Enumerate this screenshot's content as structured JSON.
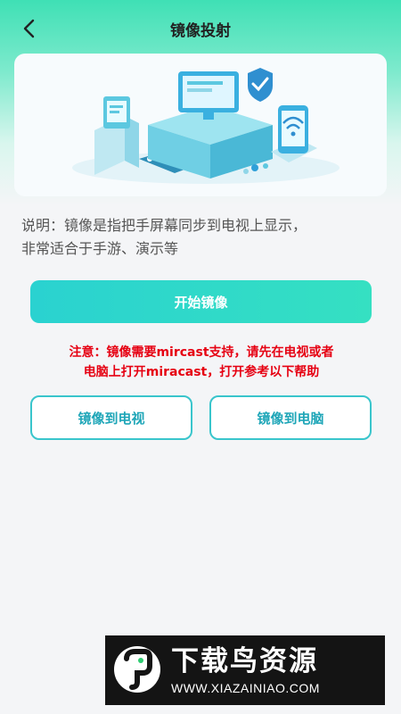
{
  "header": {
    "title": "镜像投射",
    "back_icon": "chevron-left-icon"
  },
  "banner": {
    "illustration": "screen-mirroring-illustration"
  },
  "description": {
    "line1": "说明：镜像是指把手屏幕同步到电视上显示，",
    "line2": "非常适合于手游、演示等"
  },
  "start_button": {
    "label": "开始镜像"
  },
  "notice": {
    "line1": "注意：镜像需要mircast支持，请先在电视或者",
    "line2": "电脑上打开miracast，打开参考以下帮助"
  },
  "options": {
    "tv_label": "镜像到电视",
    "pc_label": "镜像到电脑"
  },
  "watermark": {
    "title": "下载鸟资源",
    "url": "WWW.XIAZAINIAO.COM"
  },
  "colors": {
    "accent": "#33d6c8",
    "notice_red": "#e60012",
    "outline": "#39c5cc"
  }
}
